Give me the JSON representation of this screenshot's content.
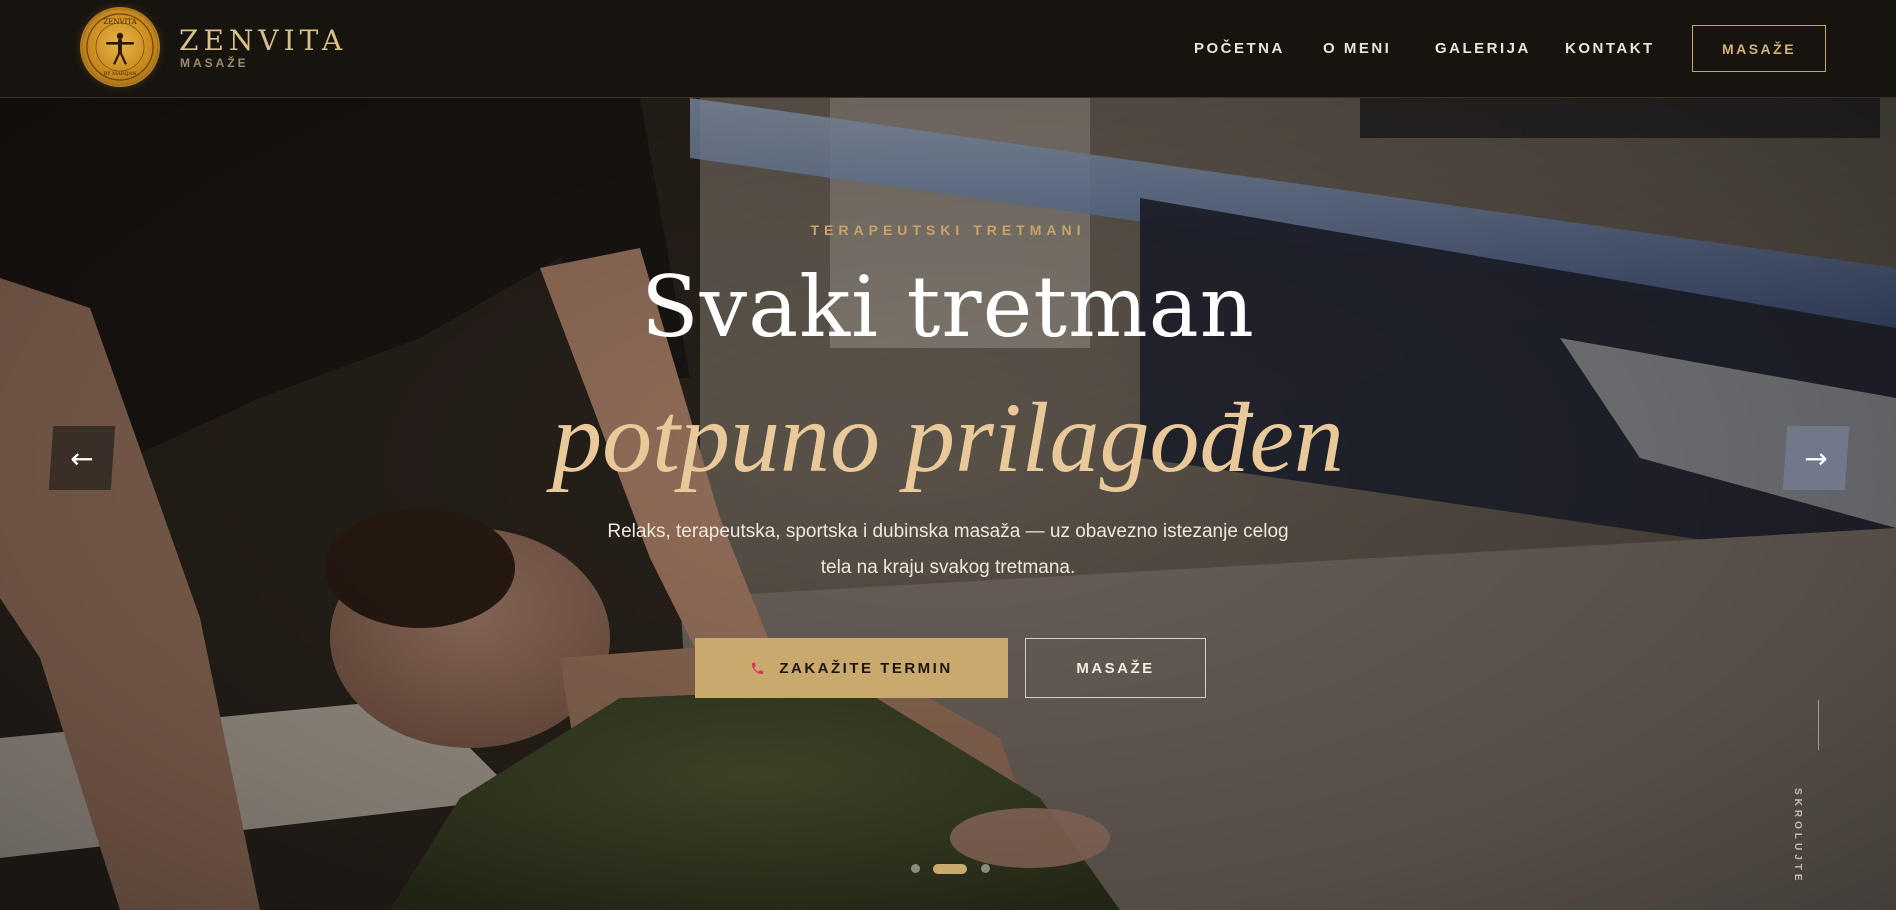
{
  "brand": {
    "name": "ZENVITA",
    "subtitle": "MASAŽE",
    "logo_text_top": "ZENVITA",
    "logo_text_bottom": "BY MARIJAN"
  },
  "nav": {
    "items": [
      {
        "label": "POČETNA"
      },
      {
        "label": "O MENI"
      },
      {
        "label": "GALERIJA"
      },
      {
        "label": "KONTAKT"
      }
    ],
    "cta_label": "MASAŽE"
  },
  "hero": {
    "eyebrow": "TERAPEUTSKI TRETMANI",
    "headline_line1": "Svaki tretman",
    "headline_line2": "potpuno prilagođen",
    "description": "Relaks, terapeutska, sportska i dubinska masaža — uz obavezno istezanje celog tela na kraju svakog tretmana.",
    "primary_button": {
      "label": "ZAKAŽITE TERMIN",
      "icon": "phone-icon"
    },
    "secondary_button": {
      "label": "MASAŽE"
    },
    "prev_arrow": "←",
    "next_arrow": "→",
    "scroll_label": "SKROLUJTE",
    "slides": {
      "count": 3,
      "active_index": 1
    }
  },
  "colors": {
    "accent_gold": "#c9a96e",
    "header_bg": "#17130f",
    "phone_icon": "#d8345f"
  }
}
